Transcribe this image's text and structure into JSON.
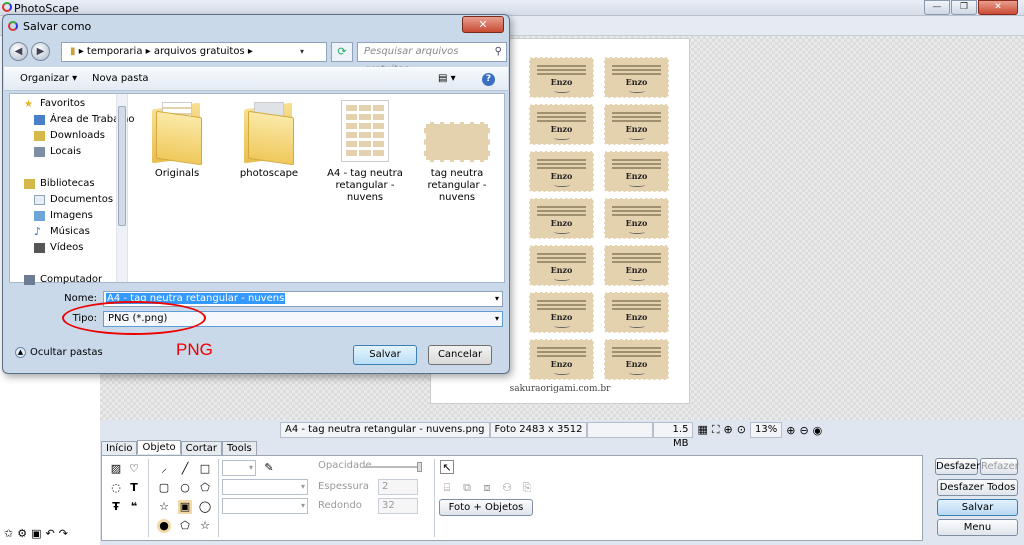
{
  "app": {
    "title": "PhotoScape",
    "window_controls": [
      "—",
      "❐",
      "✕"
    ]
  },
  "canvas": {
    "tag_name": "Enzo",
    "watermark": "sakuraorigami.com.br",
    "tag_rows": 7,
    "tag_cols": 2
  },
  "statusbar": {
    "filename": "A4 - tag neutra retangular - nuvens.png",
    "photo_size": "Foto 2483 x 3512",
    "empty_cell": "",
    "file_size": "1.5 MB",
    "zoom": "13%",
    "icons": [
      "checker-icon",
      "fit-icon",
      "zoom-actual-icon",
      "zoom-fit-icon",
      "zoom-in-icon",
      "zoom-out-icon",
      "zoom-reset-icon"
    ]
  },
  "tabs": [
    "Início",
    "Objeto",
    "Cortar",
    "Tools"
  ],
  "object_panel": {
    "opacity_label": "Opacidade",
    "thickness_label": "Espessura",
    "thickness_value": "2",
    "rounded_label": "Redondo",
    "rounded_value": "32",
    "photo_objects_button": "Foto + Objetos"
  },
  "right_buttons": {
    "undo": "Desfazer",
    "redo": "Refazer",
    "undo_all": "Desfazer Todos",
    "save": "Salvar",
    "menu": "Menu"
  },
  "dialog": {
    "title": "Salvar como",
    "close": "✕",
    "path": [
      "temporaria",
      "arquivos gratuitos"
    ],
    "search_placeholder": "Pesquisar arquivos gratuitos",
    "organize": "Organizar ▾",
    "new_folder": "Nova pasta",
    "nav": {
      "favorites": "Favoritos",
      "favorites_items": [
        "Área de Trabalho",
        "Downloads",
        "Locais"
      ],
      "libraries": "Bibliotecas",
      "libraries_items": [
        "Documentos",
        "Imagens",
        "Músicas",
        "Vídeos"
      ],
      "computer": "Computador"
    },
    "files": [
      {
        "name": "Originals"
      },
      {
        "name": "photoscape"
      },
      {
        "name": "A4 - tag neutra retangular - nuvens"
      },
      {
        "name": "tag neutra retangular - nuvens"
      }
    ],
    "name_label": "Nome:",
    "name_value": "A4 - tag neutra retangular - nuvens",
    "type_label": "Tipo:",
    "type_value": "PNG (*.png)",
    "hide_folders": "Ocultar pastas",
    "save_button": "Salvar",
    "cancel_button": "Cancelar"
  },
  "annotation": {
    "text": "PNG",
    "color": "#e00000"
  }
}
